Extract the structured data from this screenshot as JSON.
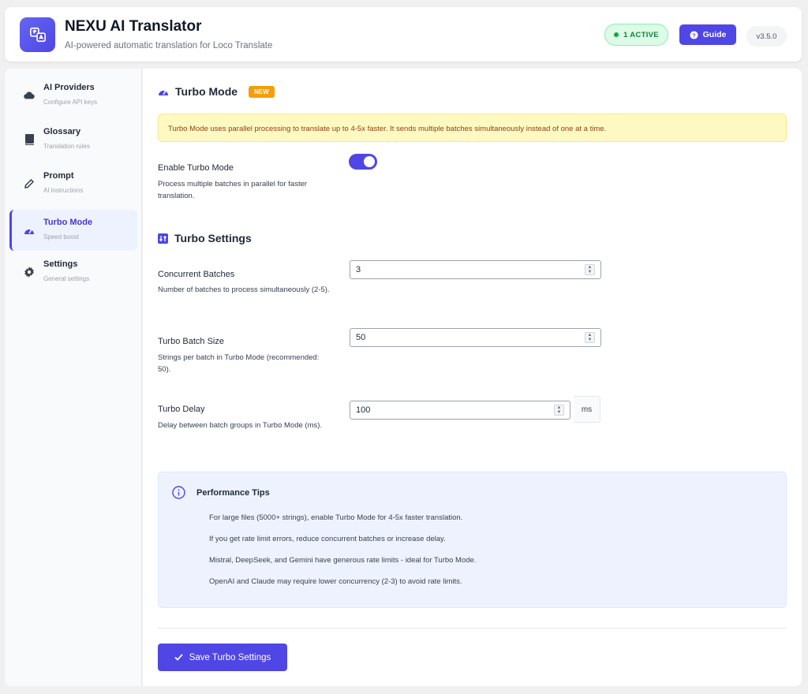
{
  "header": {
    "title": "NEXU AI Translator",
    "subtitle": "AI-powered automatic translation for Loco Translate",
    "active_badge": "1 ACTIVE",
    "guide_label": "Guide",
    "version": "v3.5.0"
  },
  "sidebar": {
    "items": [
      {
        "label": "AI Providers",
        "sub": "Configure API keys",
        "icon": "cloud-icon"
      },
      {
        "label": "Glossary",
        "sub": "Translation rules",
        "icon": "book-icon"
      },
      {
        "label": "Prompt",
        "sub": "AI instructions",
        "icon": "pencil-icon"
      },
      {
        "label": "Turbo Mode",
        "sub": "Speed boost",
        "icon": "gauge-icon",
        "active": true
      },
      {
        "label": "Settings",
        "sub": "General settings",
        "icon": "gear-icon"
      }
    ]
  },
  "main": {
    "title": "Turbo Mode",
    "new_badge": "NEW",
    "notice": "Turbo Mode uses parallel processing to translate up to 4-5x faster. It sends multiple batches simultaneously instead of one at a time.",
    "enable": {
      "label": "Enable Turbo Mode",
      "desc": "Process multiple batches in parallel for faster translation.",
      "enabled": true
    },
    "settings_title": "Turbo Settings",
    "concurrent": {
      "label": "Concurrent Batches",
      "desc": "Number of batches to process simultaneously (2-5).",
      "value": "3"
    },
    "batch_size": {
      "label": "Turbo Batch Size",
      "desc": "Strings per batch in Turbo Mode (recommended: 50).",
      "value": "50"
    },
    "delay": {
      "label": "Turbo Delay",
      "desc": "Delay between batch groups in Turbo Mode (ms).",
      "value": "100",
      "unit": "ms"
    },
    "tips": {
      "title": "Performance Tips",
      "items": [
        "For large files (5000+ strings), enable Turbo Mode for 4-5x faster translation.",
        "If you get rate limit errors, reduce concurrent batches or increase delay.",
        "Mistral, DeepSeek, and Gemini have generous rate limits - ideal for Turbo Mode.",
        "OpenAI and Claude may require lower concurrency (2-3) to avoid rate limits."
      ]
    },
    "save_label": "Save Turbo Settings"
  },
  "colors": {
    "accent": "#4f46e5",
    "active_green": "#16a34a",
    "new_badge": "#f59e0b",
    "notice_bg": "#fef9c3"
  }
}
